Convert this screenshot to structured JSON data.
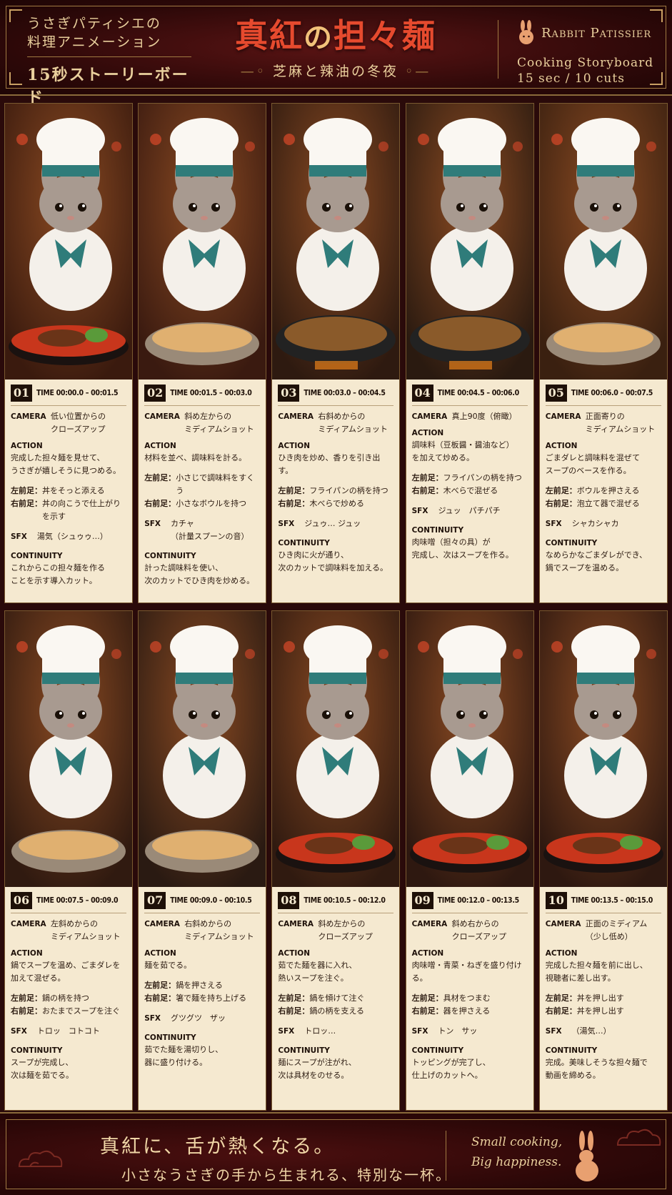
{
  "header": {
    "left_line1": "うさぎパティシエの",
    "left_line2": "料理アニメーション",
    "left_line3": "15秒ストーリーボード",
    "title_part1": "真紅",
    "title_part2": "の",
    "title_part3": "担々麺",
    "subtitle": "芝麻と辣油の冬夜",
    "brand": "Rabbit Patissier",
    "right_line1": "Cooking Storyboard",
    "right_line2": "15 sec / 10 cuts"
  },
  "labels": {
    "time": "TIME",
    "camera": "CAMERA",
    "action": "ACTION",
    "left_foot": "左前足：",
    "right_foot": "右前足：",
    "sfx": "SFX",
    "continuity": "CONTINUITY"
  },
  "cuts": [
    {
      "num": "01",
      "time": "00:00.0 – 00:01.5",
      "camera": "低い位置からの\nクローズアップ",
      "action": "完成した担々麺を見せて、\nうさぎが嬉しそうに見つめる。",
      "left": "丼をそっと添える",
      "right": "丼の向こうで仕上がり\nを示す",
      "sfx": "湯気（シュゥゥ…）",
      "continuity": "これからこの担々麺を作る\nことを示す導入カット。"
    },
    {
      "num": "02",
      "time": "00:01.5 – 00:03.0",
      "camera": "斜め左からの\nミディアムショット",
      "action": "材料を並べ、調味料を計る。",
      "left": "小さじで調味料をすくう",
      "right": "小さなボウルを持つ",
      "sfx": "カチャ\n（計量スプーンの音）",
      "continuity": "計った調味料を使い、\n次のカットでひき肉を炒める。"
    },
    {
      "num": "03",
      "time": "00:03.0 – 00:04.5",
      "camera": "右斜めからの\nミディアムショット",
      "action": "ひき肉を炒め、香りを引き出す。",
      "left": "フライパンの柄を持つ",
      "right": "木べらで炒める",
      "sfx": "ジュゥ… ジュッ",
      "continuity": "ひき肉に火が通り、\n次のカットで調味料を加える。"
    },
    {
      "num": "04",
      "time": "00:04.5 – 00:06.0",
      "camera": "真上90度（俯瞰）",
      "action": "調味料（豆板醤・醤油など）\nを加えて炒める。",
      "left": "フライパンの柄を持つ",
      "right": "木べらで混ぜる",
      "sfx": "ジュッ　パチパチ",
      "continuity": "肉味噌（担々の具）が\n完成し、次はスープを作る。"
    },
    {
      "num": "05",
      "time": "00:06.0 – 00:07.5",
      "camera": "正面寄りの\nミディアムショット",
      "action": "ごまダレと調味料を混ぜて\nスープのベースを作る。",
      "left": "ボウルを押さえる",
      "right": "泡立て器で混ぜる",
      "sfx": "シャカシャカ",
      "continuity": "なめらかなごまダレができ、\n鍋でスープを温める。"
    },
    {
      "num": "06",
      "time": "00:07.5 – 00:09.0",
      "camera": "左斜めからの\nミディアムショット",
      "action": "鍋でスープを温め、ごまダレを\n加えて混ぜる。",
      "left": "鍋の柄を持つ",
      "right": "おたまでスープを注ぐ",
      "sfx": "トロッ　コトコト",
      "continuity": "スープが完成し、\n次は麺を茹でる。"
    },
    {
      "num": "07",
      "time": "00:09.0 – 00:10.5",
      "camera": "右斜めからの\nミディアムショット",
      "action": "麺を茹でる。",
      "left": "鍋を押さえる",
      "right": "箸で麺を持ち上げる",
      "sfx": "グツグツ　ザッ",
      "continuity": "茹でた麺を湯切りし、\n器に盛り付ける。"
    },
    {
      "num": "08",
      "time": "00:10.5 – 00:12.0",
      "camera": "斜め左からの\nクローズアップ",
      "action": "茹でた麺を器に入れ、\n熱いスープを注ぐ。",
      "left": "鍋を傾けて注ぐ",
      "right": "鍋の柄を支える",
      "sfx": "トロッ…",
      "continuity": "麺にスープが注がれ、\n次は具材をのせる。"
    },
    {
      "num": "09",
      "time": "00:12.0 – 00:13.5",
      "camera": "斜め右からの\nクローズアップ",
      "action": "肉味噌・青菜・ねぎを盛り付ける。",
      "left": "具材をつまむ",
      "right": "器を押さえる",
      "sfx": "トン　サッ",
      "continuity": "トッピングが完了し、\n仕上げのカットへ。"
    },
    {
      "num": "10",
      "time": "00:13.5 – 00:15.0",
      "camera": "正面のミディアム\n（少し低め）",
      "action": "完成した担々麺を前に出し、\n視聴者に差し出す。",
      "left": "丼を押し出す",
      "right": "丼を押し出す",
      "sfx": "（湯気…）",
      "continuity": "完成。美味しそうな担々麺で\n動画を締める。"
    }
  ],
  "footer": {
    "main": "真紅に、舌が熱くなる。",
    "sub": "小さなうさぎの手から生まれる、特別な一杯。",
    "right_line1": "Small cooking,",
    "right_line2": "Big happiness."
  },
  "colors": {
    "title_red": "#e64a2e",
    "gold": "#e9cf9c",
    "panel_bg": "#f5e9d0",
    "dark_bg": "#2a0a0a"
  }
}
